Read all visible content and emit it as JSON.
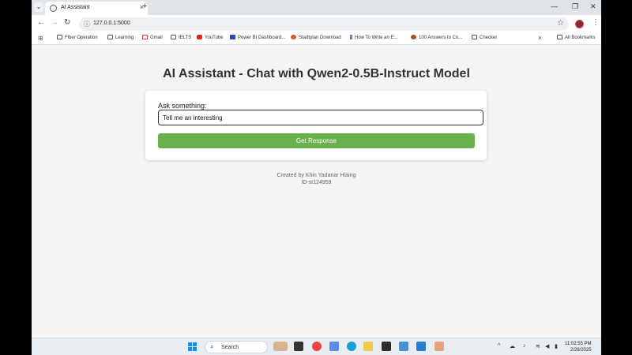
{
  "browser": {
    "tab_title": "AI Assistant",
    "url": "127.0.0.1:5000"
  },
  "bookmarks": {
    "items": [
      "Fiber Operation",
      "Learning",
      "Gmail",
      "IELTS",
      "YouTube",
      "Power BI Dashboard...",
      "Stadtplan Download",
      "How To Write an E...",
      "100 Answers to Co...",
      "Checker"
    ],
    "all_bookmarks": "All Bookmarks"
  },
  "app": {
    "title": "AI Assistant - Chat with Qwen2-0.5B-Instruct Model",
    "ask_label": "Ask something:",
    "input_value": "Tell me an interesting",
    "button_label": "Get Response",
    "footer_line1": "Created by Khin Yadanar Hlaing",
    "footer_line2": "ID-st124959"
  },
  "taskbar": {
    "search_label": "Search",
    "time": "11:02:55 PM",
    "date": "2/28/2025"
  },
  "colors": {
    "button": "#6ab04c",
    "page_bg": "#f5f5f5",
    "title_text": "#333333"
  }
}
